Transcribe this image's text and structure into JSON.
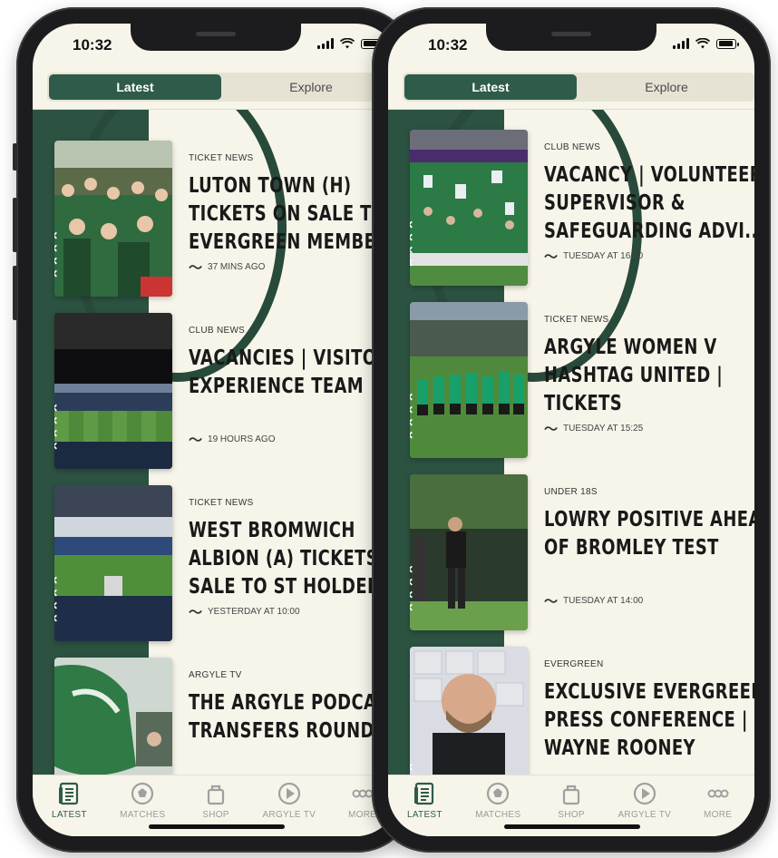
{
  "colors": {
    "brand_green": "#2e5b4a",
    "band_green": "#2c5242",
    "background": "#f7f5ea"
  },
  "phones": [
    {
      "status": {
        "time": "10:32"
      },
      "segments": [
        "Latest",
        "Explore"
      ],
      "active_segment": "Latest",
      "articles": [
        {
          "category": "TICKET NEWS",
          "title": "LUTON TOWN (H)\nTICKETS ON SALE TO\nEVERGREEN MEMBERS",
          "time": "37 MINS AGO",
          "image": "crowd"
        },
        {
          "category": "CLUB NEWS",
          "title": "VACANCIES | VISITOR\nEXPERIENCE TEAM",
          "time": "19 HOURS AGO",
          "image": "stadium-dark"
        },
        {
          "category": "TICKET NEWS",
          "title": "WEST BROMWICH\nALBION (A) TICKETS ON\nSALE TO ST HOLDERS",
          "time": "YESTERDAY AT 10:00",
          "image": "stadium-blue"
        },
        {
          "category": "ARGYLE TV",
          "title": "THE ARGYLE PODCAST |\nTRANSFERS ROUND-UP",
          "time": "",
          "image": "flag"
        }
      ],
      "tabs": [
        {
          "label": "LATEST",
          "icon": "news-icon",
          "active": true
        },
        {
          "label": "MATCHES",
          "icon": "football-icon"
        },
        {
          "label": "SHOP",
          "icon": "shopping-bag-icon"
        },
        {
          "label": "ARGYLE TV",
          "icon": "play-icon"
        },
        {
          "label": "MORE",
          "icon": "more-icon"
        }
      ]
    },
    {
      "status": {
        "time": "10:32"
      },
      "segments": [
        "Latest",
        "Explore"
      ],
      "active_segment": "Latest",
      "articles": [
        {
          "category": "CLUB NEWS",
          "title": "VACANCY | VOLUNTEER\nSUPERVISOR &\nSAFEGUARDING ADVI...",
          "time": "TUESDAY AT 16:00",
          "image": "fans-flags"
        },
        {
          "category": "TICKET NEWS",
          "title": "ARGYLE WOMEN V\nHASHTAG UNITED |\nTICKETS",
          "time": "TUESDAY AT 15:25",
          "image": "women-team"
        },
        {
          "category": "UNDER 18S",
          "title": "LOWRY POSITIVE AHEAD\nOF BROMLEY TEST",
          "time": "TUESDAY AT 14:00",
          "image": "coach"
        },
        {
          "category": "EVERGREEN",
          "title": "EXCLUSIVE EVERGREEN\nPRESS CONFERENCE |\nWAYNE ROONEY",
          "time": "",
          "image": "press"
        }
      ],
      "tabs": [
        {
          "label": "LATEST",
          "icon": "news-icon",
          "active": true
        },
        {
          "label": "MATCHES",
          "icon": "football-icon"
        },
        {
          "label": "SHOP",
          "icon": "shopping-bag-icon"
        },
        {
          "label": "ARGYLE TV",
          "icon": "play-icon"
        },
        {
          "label": "MORE",
          "icon": "more-icon"
        }
      ]
    }
  ]
}
